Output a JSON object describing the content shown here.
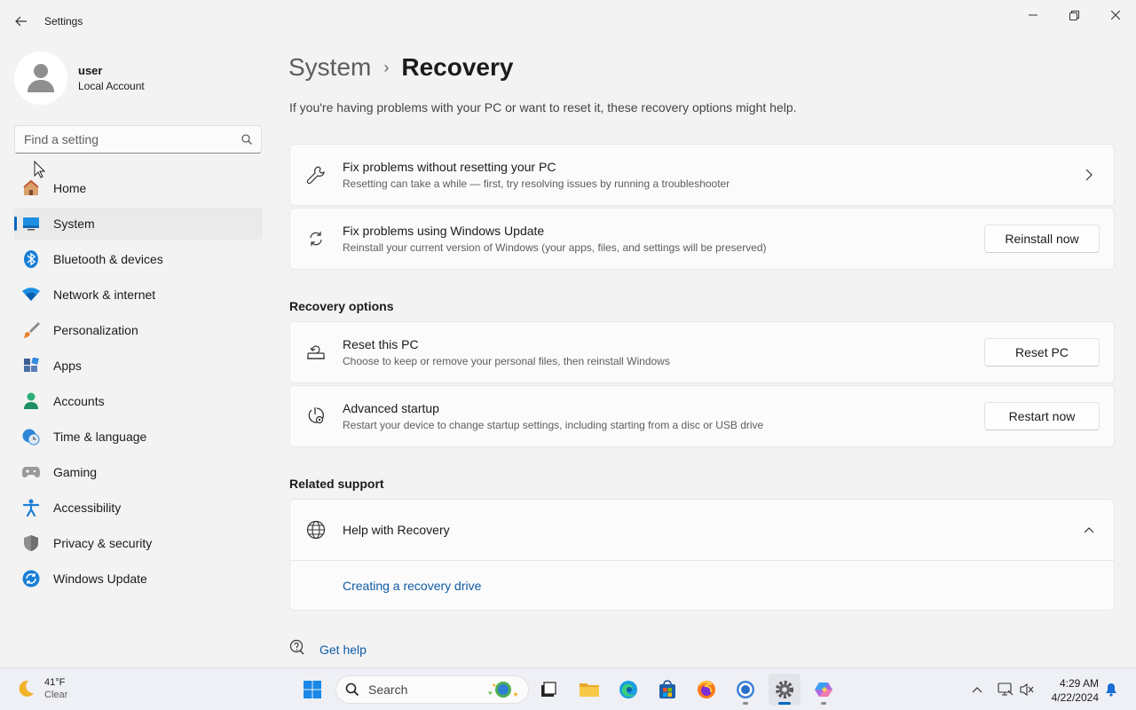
{
  "window": {
    "title": "Settings",
    "back_icon": "back-arrow-icon",
    "minimize_icon": "minimize-icon",
    "maximize_icon": "restore-icon",
    "close_icon": "close-icon"
  },
  "profile": {
    "name": "user",
    "account_type": "Local Account"
  },
  "search": {
    "placeholder": "Find a setting",
    "value": ""
  },
  "sidebar": {
    "items": [
      {
        "label": "Home",
        "icon": "home-icon"
      },
      {
        "label": "System",
        "icon": "system-icon",
        "selected": true
      },
      {
        "label": "Bluetooth & devices",
        "icon": "bluetooth-icon"
      },
      {
        "label": "Network & internet",
        "icon": "wifi-icon"
      },
      {
        "label": "Personalization",
        "icon": "brush-icon"
      },
      {
        "label": "Apps",
        "icon": "apps-icon"
      },
      {
        "label": "Accounts",
        "icon": "accounts-icon"
      },
      {
        "label": "Time & language",
        "icon": "clock-globe-icon"
      },
      {
        "label": "Gaming",
        "icon": "gamepad-icon"
      },
      {
        "label": "Accessibility",
        "icon": "accessibility-icon"
      },
      {
        "label": "Privacy & security",
        "icon": "shield-icon"
      },
      {
        "label": "Windows Update",
        "icon": "update-icon"
      }
    ]
  },
  "breadcrumb": {
    "parent": "System",
    "separator": "›",
    "current": "Recovery"
  },
  "intro": "If you're having problems with your PC or want to reset it, these recovery options might help.",
  "cards": {
    "fix_without_reset": {
      "title": "Fix problems without resetting your PC",
      "description": "Resetting can take a while — first, try resolving issues by running a troubleshooter"
    },
    "windows_update": {
      "title": "Fix problems using Windows Update",
      "description": "Reinstall your current version of Windows (your apps, files, and settings will be preserved)",
      "button": "Reinstall now"
    }
  },
  "recovery_options": {
    "heading": "Recovery options",
    "reset_pc": {
      "title": "Reset this PC",
      "description": "Choose to keep or remove your personal files, then reinstall Windows",
      "button": "Reset PC"
    },
    "advanced_startup": {
      "title": "Advanced startup",
      "description": "Restart your device to change startup settings, including starting from a disc or USB drive",
      "button": "Restart now"
    }
  },
  "related_support": {
    "heading": "Related support",
    "help_title": "Help with Recovery",
    "expanded": true,
    "link": "Creating a recovery drive"
  },
  "get_help": "Get help",
  "taskbar": {
    "weather": {
      "temp": "41°F",
      "condition": "Clear"
    },
    "search_label": "Search",
    "apps": [
      "start-icon",
      "file-explorer-icon",
      "folder-icon",
      "edge-icon",
      "store-icon",
      "firefox-icon",
      "chrome-icon",
      "settings-icon",
      "copilot-icon"
    ],
    "clock": {
      "time": "4:29 AM",
      "date": "4/22/2024"
    }
  },
  "colors": {
    "accent": "#0067c0",
    "link": "#0f5aa5",
    "background": "#f3f3f3",
    "card": "#fbfbfb"
  }
}
